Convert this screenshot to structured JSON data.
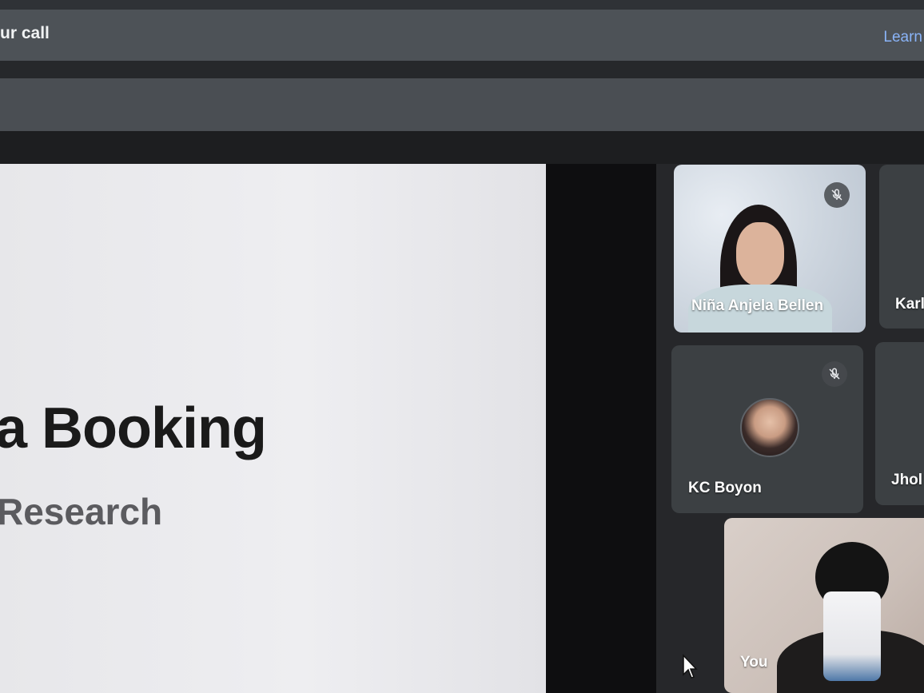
{
  "banner": {
    "text": "ur call",
    "link": "Learn"
  },
  "slide": {
    "title": "a Booking",
    "subtitle": "Research"
  },
  "participants": [
    {
      "name": "Niña Anjela Bellen",
      "muted": true,
      "video": true
    },
    {
      "name": "Karl",
      "muted": false,
      "video": false
    },
    {
      "name": "KC Boyon",
      "muted": true,
      "video": false
    },
    {
      "name": "Jhol",
      "muted": false,
      "video": false
    },
    {
      "name": "You",
      "muted": false,
      "video": true
    }
  ],
  "icons": {
    "muted": "mic-off-icon",
    "pointer": "mouse-cursor-icon"
  },
  "colors": {
    "background": "#202124",
    "tile": "#3c4043",
    "link": "#8ab4f8"
  }
}
